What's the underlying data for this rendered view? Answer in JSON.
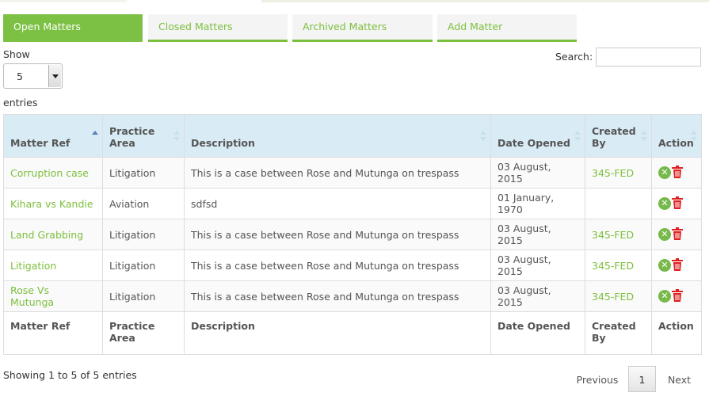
{
  "tabs": [
    {
      "label": "Open Matters"
    },
    {
      "label": "Closed Matters"
    },
    {
      "label": "Archived Matters"
    },
    {
      "label": "Add Matter"
    }
  ],
  "length": {
    "show_label": "Show",
    "value": "5",
    "entries_label": "entries"
  },
  "search": {
    "label": "Search:",
    "value": ""
  },
  "table": {
    "headers": [
      "Matter Ref",
      "Practice Area",
      "Description",
      "Date Opened",
      "Created By",
      "Action"
    ],
    "rows": [
      {
        "ref": "Corruption case",
        "area": "Litigation",
        "desc": "This is a case between Rose and Mutunga on trespass",
        "date": "03 August, 2015",
        "by": "345-FED"
      },
      {
        "ref": "Kihara vs Kandie",
        "area": "Aviation",
        "desc": "sdfsd",
        "date": "01 January, 1970",
        "by": ""
      },
      {
        "ref": "Land Grabbing",
        "area": "Litigation",
        "desc": "This is a case between Rose and Mutunga on trespass",
        "date": "03 August, 2015",
        "by": "345-FED"
      },
      {
        "ref": "Litigation",
        "area": "Litigation",
        "desc": "This is a case between Rose and Mutunga on trespass",
        "date": "03 August, 2015",
        "by": "345-FED"
      },
      {
        "ref": "Rose Vs Mutunga",
        "area": "Litigation",
        "desc": "This is a case between Rose and Mutunga on trespass",
        "date": "03 August, 2015",
        "by": "345-FED"
      }
    ],
    "row_action_icons": [
      "close-circle-icon",
      "trash-icon"
    ]
  },
  "footer": {
    "info": "Showing 1 to 5 of 5 entries",
    "previous": "Previous",
    "page": "1",
    "next": "Next"
  },
  "colors": {
    "accent": "#7cc144",
    "link": "#7cbf3c",
    "header_bg": "#d9ebf5",
    "delete": "#e02020"
  }
}
